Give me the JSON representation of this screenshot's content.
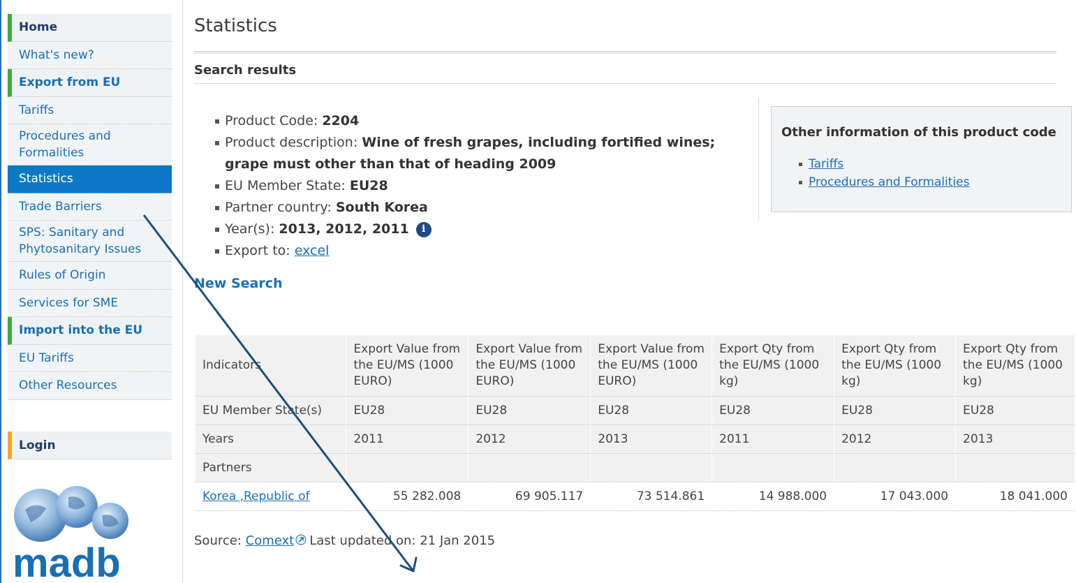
{
  "sidebar": {
    "items": [
      {
        "label": "Home",
        "kind": "section-dark"
      },
      {
        "label": "What's new?",
        "kind": "item"
      },
      {
        "label": "Export from EU",
        "kind": "section-blue"
      },
      {
        "label": "Tariffs",
        "kind": "item"
      },
      {
        "label": "Procedures and Formalities",
        "kind": "item"
      },
      {
        "label": "Statistics",
        "kind": "active"
      },
      {
        "label": "Trade Barriers",
        "kind": "item"
      },
      {
        "label": "SPS: Sanitary and Phytosanitary Issues",
        "kind": "item"
      },
      {
        "label": "Rules of Origin",
        "kind": "item"
      },
      {
        "label": "Services for SME",
        "kind": "item"
      },
      {
        "label": "Import into the EU",
        "kind": "section-blue"
      },
      {
        "label": "EU Tariffs",
        "kind": "item"
      },
      {
        "label": "Other Resources",
        "kind": "item"
      }
    ],
    "login_label": "Login",
    "logo_text": "madb"
  },
  "main": {
    "page_title": "Statistics",
    "section_title": "Search results",
    "info": {
      "product_code_label": "Product Code:",
      "product_code": "2204",
      "description_label": "Product description:",
      "description": "Wine of fresh grapes, including fortified wines; grape must other than that of heading 2009",
      "member_state_label": "EU Member State:",
      "member_state": "EU28",
      "partner_label": "Partner country:",
      "partner": "South Korea",
      "years_label": "Year(s):",
      "years": "2013, 2012, 2011",
      "export_label": "Export to:",
      "export_link": "excel"
    },
    "other_info": {
      "title": "Other information of this product code",
      "links": [
        "Tariffs",
        "Procedures and Formalities"
      ]
    },
    "new_search": "New Search",
    "table": {
      "header": [
        "Indicators",
        "Export Value from the EU/MS (1000 EURO)",
        "Export Value from the EU/MS (1000 EURO)",
        "Export Value from the EU/MS (1000 EURO)",
        "Export Qty from the EU/MS (1000 kg)",
        "Export Qty from the EU/MS (1000 kg)",
        "Export Qty from the EU/MS (1000 kg)"
      ],
      "member_states_label": "EU Member State(s)",
      "member_states": [
        "EU28",
        "EU28",
        "EU28",
        "EU28",
        "EU28",
        "EU28"
      ],
      "years_label": "Years",
      "years": [
        "2011",
        "2012",
        "2013",
        "2011",
        "2012",
        "2013"
      ],
      "partners_label": "Partners",
      "rows": [
        {
          "partner": "Korea ,Republic of",
          "values": [
            "55 282.008",
            "69 905.117",
            "73 514.861",
            "14 988.000",
            "17 043.000",
            "18 041.000"
          ]
        }
      ]
    },
    "source": {
      "prefix": "Source:",
      "link": "Comext",
      "updated": "Last updated on: 21 Jan 2015"
    }
  },
  "colors": {
    "accent": "#1a6fb3",
    "active_nav": "#0b79c6",
    "section_marker": "#3daa3d",
    "login_marker": "#f5a623",
    "annotation_arrow": "#1f4e79"
  }
}
